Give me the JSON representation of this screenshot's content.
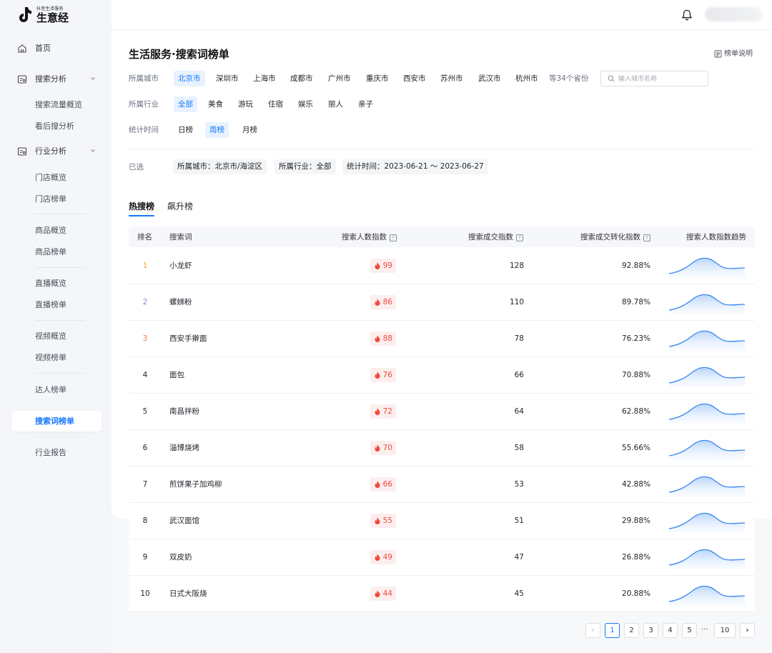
{
  "brand": {
    "small": "抖音生活服务",
    "big": "生意经"
  },
  "sidebar": {
    "home": "首页",
    "search_analysis": {
      "label": "搜索分析",
      "children": [
        "搜索流量概览",
        "看后搜分析"
      ]
    },
    "industry_analysis": {
      "label": "行业分析",
      "children": [
        "门店概览",
        "门店榜单",
        "商品概览",
        "商品榜单",
        "直播概览",
        "直播榜单",
        "视频概览",
        "视频榜单",
        "达人榜单",
        "搜索词榜单",
        "行业报告"
      ]
    },
    "active": "搜索词榜单"
  },
  "page": {
    "title": "生活服务·搜索词榜单",
    "rules": "榜单说明"
  },
  "filters": {
    "city_label": "所属城市",
    "cities": [
      "北京市",
      "深圳市",
      "上海市",
      "成都市",
      "广州市",
      "重庆市",
      "西安市",
      "苏州市",
      "武汉市",
      "杭州市"
    ],
    "more_cities": "等34个省份",
    "city_search_placeholder": "输入城市名称",
    "industry_label": "所属行业",
    "industries": [
      "全部",
      "美食",
      "游玩",
      "住宿",
      "娱乐",
      "丽人",
      "亲子"
    ],
    "time_label": "统计时间",
    "times": [
      "日榜",
      "周榜",
      "月榜"
    ]
  },
  "selected": {
    "label": "已选",
    "tags": [
      "所属城市：北京市/海淀区",
      "所属行业：全部",
      "统计时间：2023-06-21 ～ 2023-06-27"
    ]
  },
  "tabs": [
    "热搜榜",
    "飙升榜"
  ],
  "table": {
    "headers": [
      "排名",
      "搜索词",
      "搜索人数指数",
      "搜索成交指数",
      "搜索成交转化指数",
      "搜索人数指数趋势"
    ],
    "rows": [
      {
        "rank": "1",
        "keyword": "小龙虾",
        "search_index": "99",
        "deal_index": "128",
        "conversion": "92.88%"
      },
      {
        "rank": "2",
        "keyword": "螺蛳粉",
        "search_index": "86",
        "deal_index": "110",
        "conversion": "89.78%"
      },
      {
        "rank": "3",
        "keyword": "西安手擀面",
        "search_index": "88",
        "deal_index": "78",
        "conversion": "76.23%"
      },
      {
        "rank": "4",
        "keyword": "面包",
        "search_index": "76",
        "deal_index": "66",
        "conversion": "70.88%"
      },
      {
        "rank": "5",
        "keyword": "南昌拌粉",
        "search_index": "72",
        "deal_index": "64",
        "conversion": "62.88%"
      },
      {
        "rank": "6",
        "keyword": "淄博烧烤",
        "search_index": "70",
        "deal_index": "58",
        "conversion": "55.66%"
      },
      {
        "rank": "7",
        "keyword": "煎饼果子加鸡柳",
        "search_index": "66",
        "deal_index": "53",
        "conversion": "42.88%"
      },
      {
        "rank": "8",
        "keyword": "武汉面馆",
        "search_index": "55",
        "deal_index": "51",
        "conversion": "29.88%"
      },
      {
        "rank": "9",
        "keyword": "双皮奶",
        "search_index": "49",
        "deal_index": "47",
        "conversion": "26.88%"
      },
      {
        "rank": "10",
        "keyword": "日式大阪烧",
        "search_index": "44",
        "deal_index": "45",
        "conversion": "20.88%"
      }
    ]
  },
  "pagination": {
    "prev": "‹",
    "pages": [
      "1",
      "2",
      "3",
      "4",
      "5"
    ],
    "ellipsis": "···",
    "last": "10",
    "next": "›",
    "current": "1"
  },
  "colors": {
    "accent": "#1677ff",
    "rank1": "#f5a623",
    "rank2": "#7b8cde",
    "rank3": "#f07a3c",
    "hot": "#f04a3d"
  }
}
